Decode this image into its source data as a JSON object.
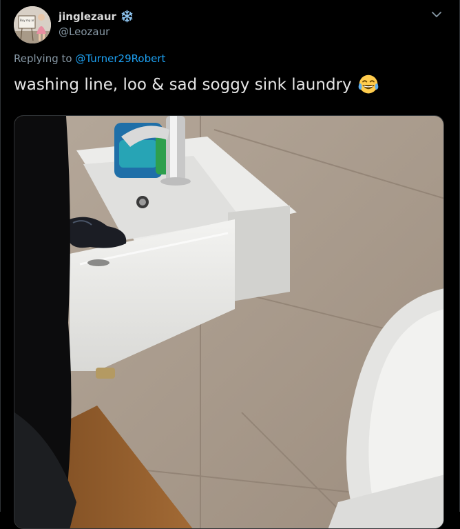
{
  "tweet": {
    "display_name": "jinglezaur",
    "handle": "@Leozaur",
    "replying_prefix": "Replying to",
    "replying_to": "@Turner29Robert",
    "text": "washing line, loo & sad soggy sink laundry",
    "emoji": "face-with-tears-of-joy",
    "badge_icon": "snowflake-icon",
    "menu_icon": "chevron-down-icon"
  },
  "avatar": {
    "sign_text": "Buy my ar"
  },
  "colors": {
    "background": "#000000",
    "link": "#1da1f2",
    "secondary_text": "#8899a6",
    "badge": "#8fc6f2"
  }
}
